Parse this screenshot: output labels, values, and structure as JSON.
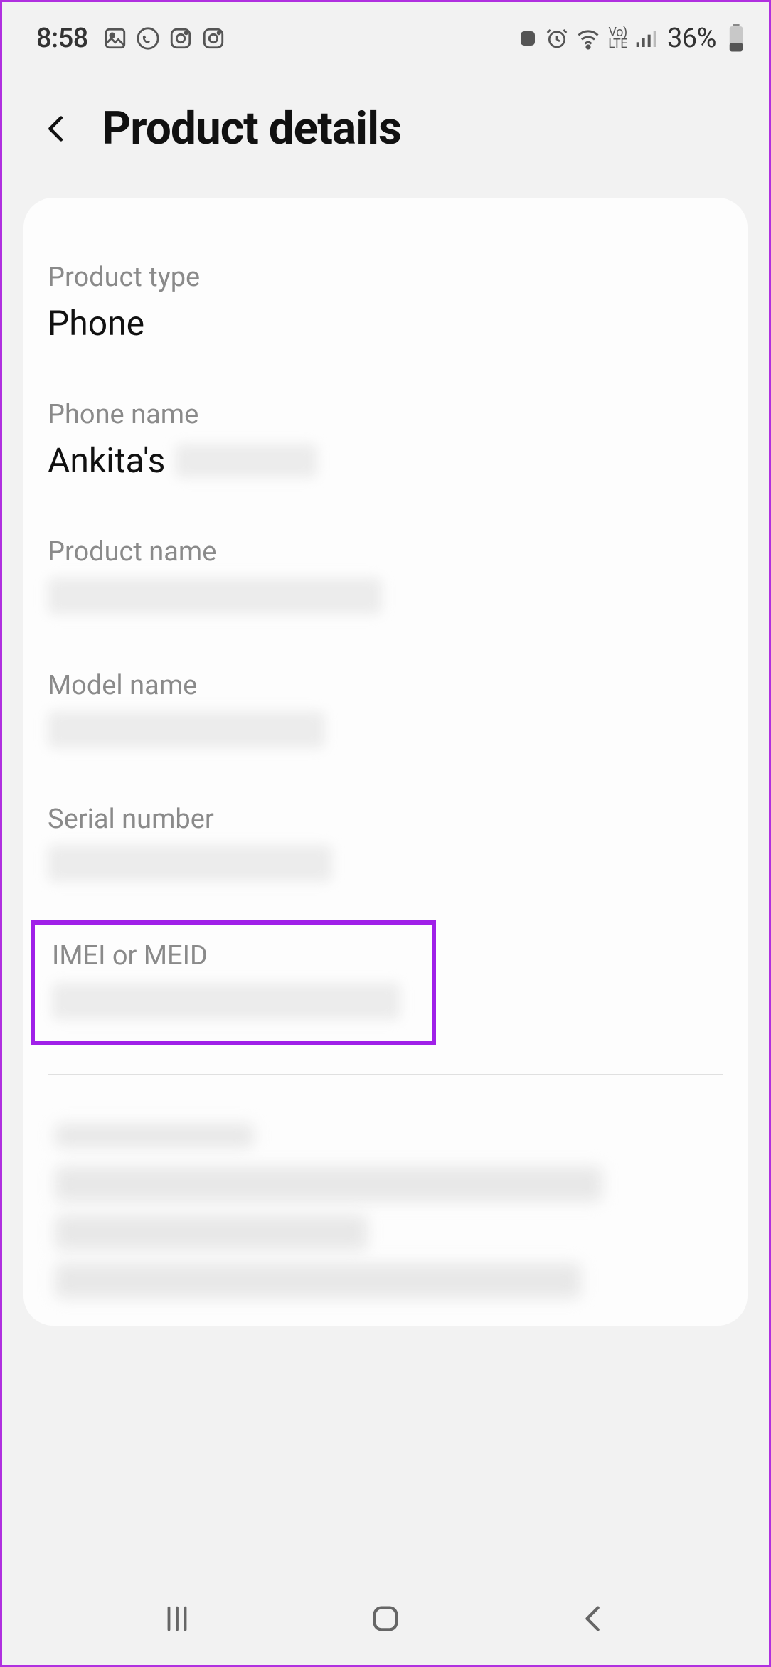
{
  "statusbar": {
    "time": "8:58",
    "icons_left": [
      "gallery-icon",
      "whatsapp-icon",
      "instagram-icon",
      "instagram-icon-2"
    ],
    "icons_right": [
      "duo-icon",
      "alarm-icon",
      "wifi-icon",
      "volte-icon",
      "signal-icon"
    ],
    "battery_percent": "36%"
  },
  "header": {
    "title": "Product details"
  },
  "fields": {
    "product_type": {
      "label": "Product type",
      "value": "Phone"
    },
    "phone_name": {
      "label": "Phone name",
      "value_prefix": "Ankita's"
    },
    "product_name": {
      "label": "Product name"
    },
    "model_name": {
      "label": "Model name"
    },
    "serial_number": {
      "label": "Serial number"
    },
    "imei": {
      "label": "IMEI or MEID"
    }
  }
}
